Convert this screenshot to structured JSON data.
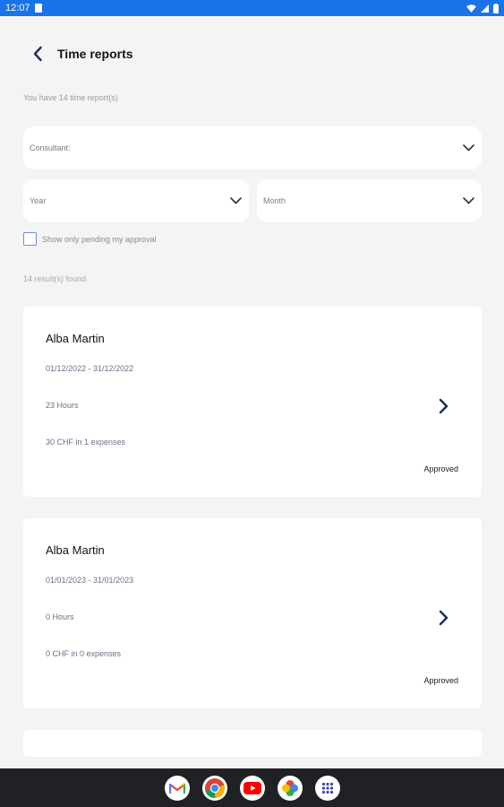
{
  "status_bar": {
    "time": "12:07"
  },
  "header": {
    "title": "Time reports"
  },
  "summary": {
    "text": "You have 14 time report(s)"
  },
  "filters": {
    "consultant_placeholder": "Consultant:",
    "year_placeholder": "Year",
    "month_placeholder": "Month",
    "pending_label": "Show only pending my approval",
    "pending_checked": false
  },
  "results": {
    "text": "14 result(s) found"
  },
  "reports": [
    {
      "name": "Alba Martin",
      "period": "01/12/2022 - 31/12/2022",
      "hours": "23 Hours",
      "expenses": "30 CHF in 1 expenses",
      "status": "Approved"
    },
    {
      "name": "Alba Martin",
      "period": "01/01/2023 - 31/01/2023",
      "hours": "0 Hours",
      "expenses": "0 CHF in 0 expenses",
      "status": "Approved"
    }
  ],
  "colors": {
    "status_bar": "#1a73e8",
    "background": "#f4f4f4",
    "card": "#ffffff",
    "accent": "#1f2a5a",
    "checkbox_border": "#6b8ed6",
    "nav_bar": "#202124"
  },
  "dock_apps": [
    "gmail-icon",
    "chrome-icon",
    "youtube-icon",
    "photos-icon",
    "app-drawer-icon"
  ]
}
